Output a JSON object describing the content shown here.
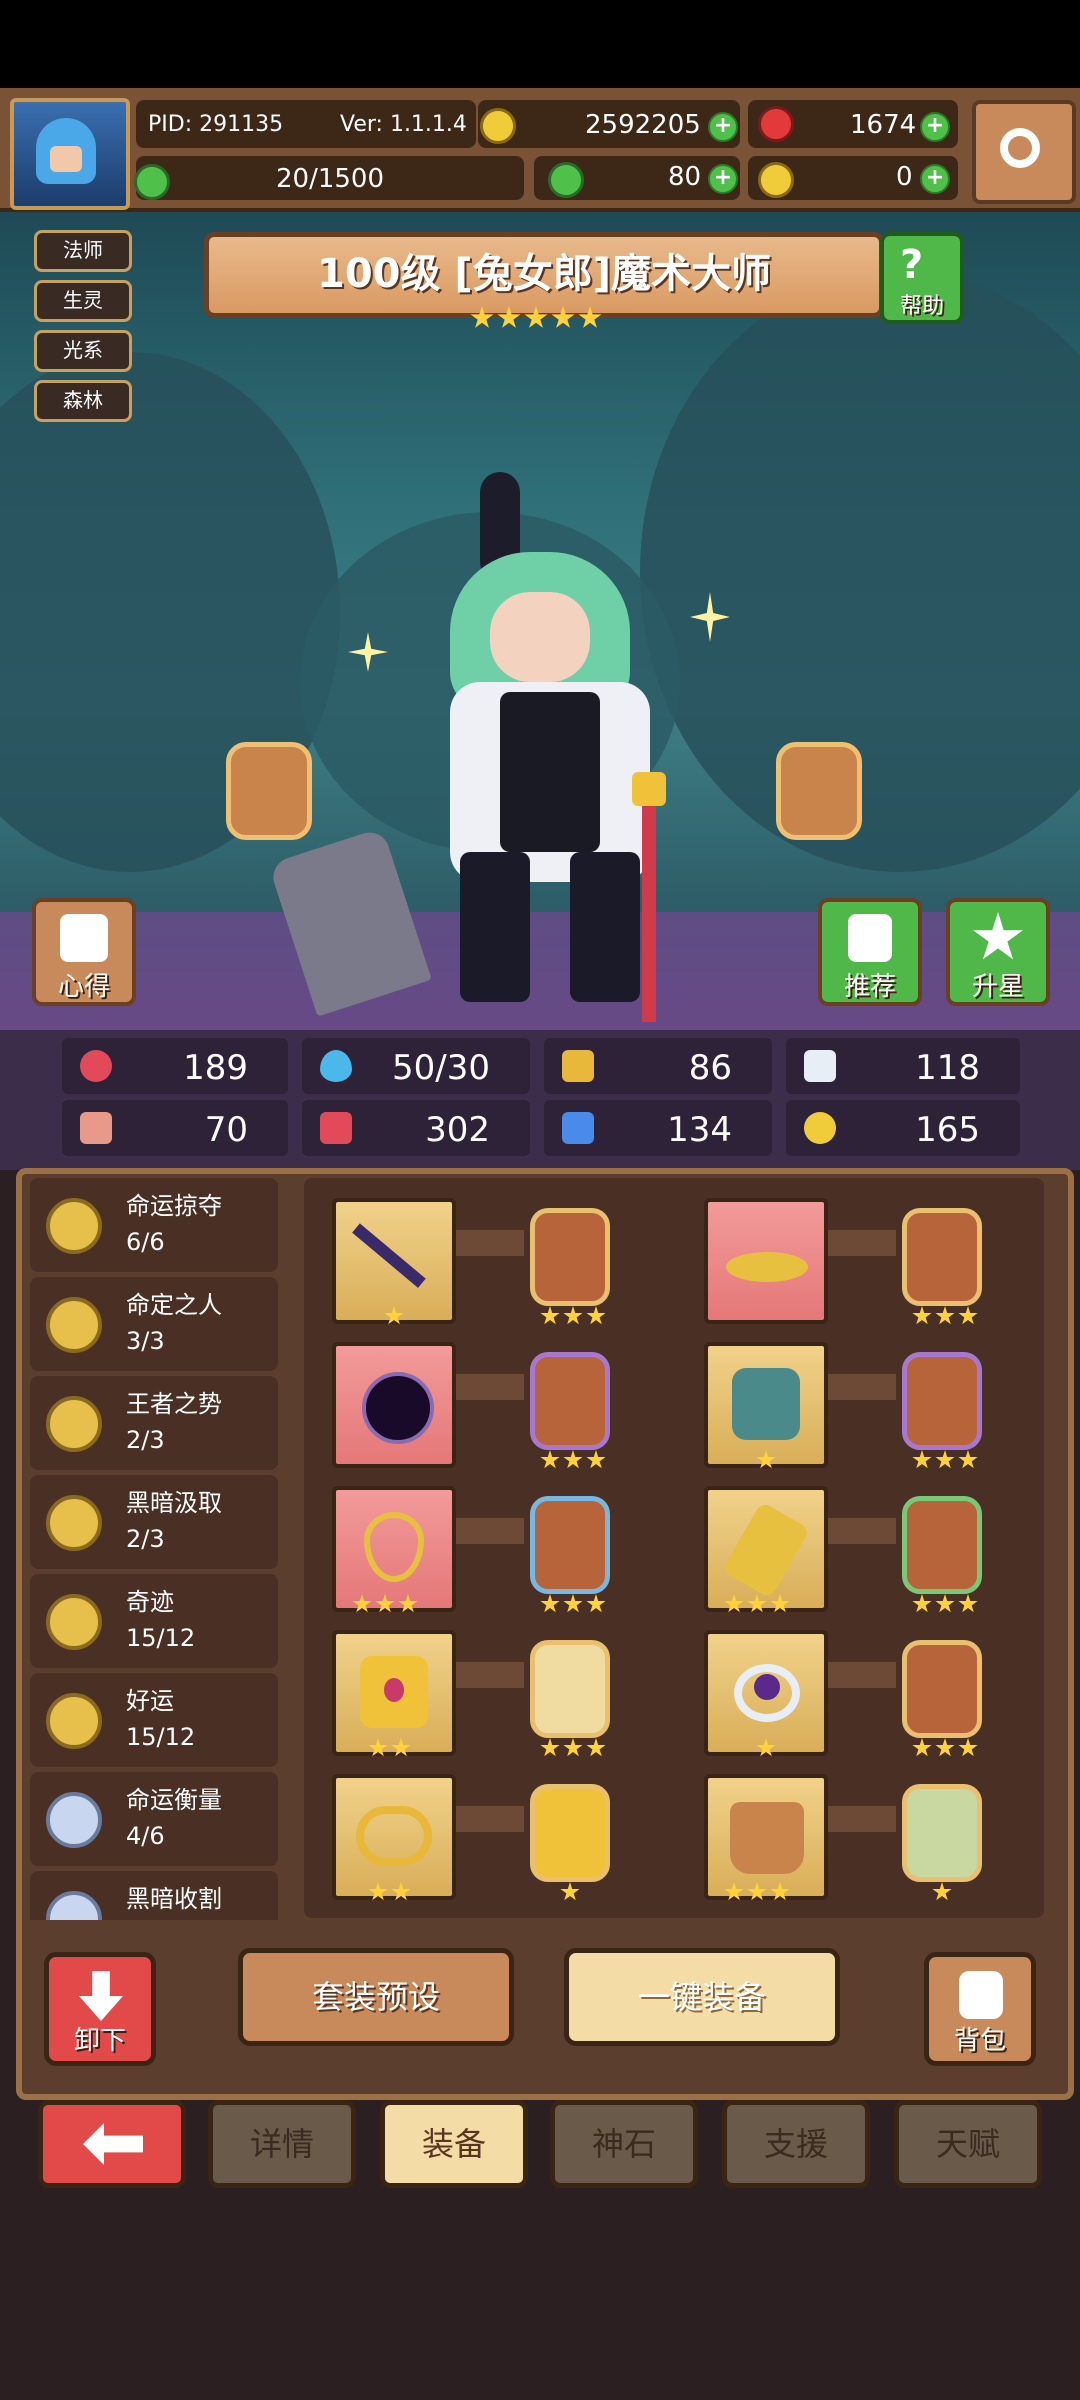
{
  "hud": {
    "pid": "PID: 291135",
    "version": "Ver: 1.1.1.4",
    "gold": "2592205",
    "gems": "1674",
    "stamina": "20/1500",
    "clover": "80",
    "key": "0"
  },
  "tags": [
    "法师",
    "生灵",
    "光系",
    "森林"
  ],
  "character": {
    "title": "100级 [兔女郎]魔术大师",
    "stars": 5
  },
  "buttons": {
    "help": "帮助",
    "insights": "心得",
    "recommend": "推荐",
    "star_up": "升星",
    "unequip": "卸下",
    "preset": "套装预设",
    "auto_equip": "一键装备",
    "bag": "背包"
  },
  "stats": [
    "189",
    "50/30",
    "86",
    "118",
    "70",
    "302",
    "134",
    "165"
  ],
  "sets": [
    {
      "name": "命运掠夺",
      "count": "6/6"
    },
    {
      "name": "命定之人",
      "count": "3/3"
    },
    {
      "name": "王者之势",
      "count": "2/3"
    },
    {
      "name": "黑暗汲取",
      "count": "2/3"
    },
    {
      "name": "奇迹",
      "count": "15/12"
    },
    {
      "name": "好运",
      "count": "15/12"
    },
    {
      "name": "命运衡量",
      "count": "4/6"
    },
    {
      "name": "黑暗收割",
      "count": ""
    }
  ],
  "tabs": [
    "详情",
    "装备",
    "神石",
    "支援",
    "天赋"
  ],
  "colors": {
    "accent": "#e8c070",
    "back": "#e24a4a",
    "green": "#4fb848"
  }
}
